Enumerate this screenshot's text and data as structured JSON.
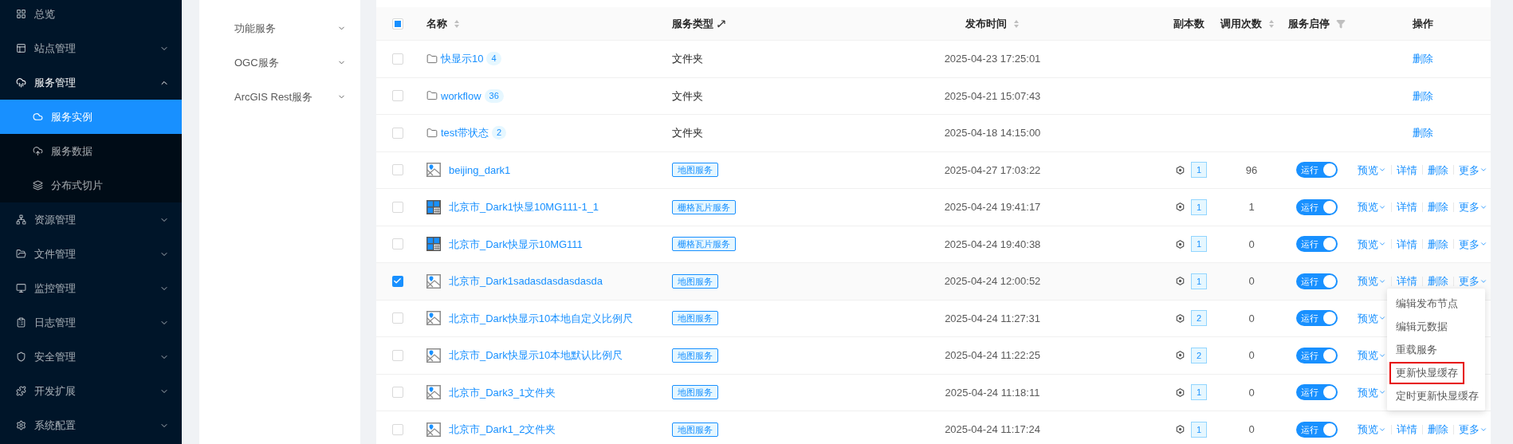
{
  "sidebar": {
    "items": [
      {
        "label": "总览",
        "kind": "link"
      },
      {
        "label": "站点管理",
        "kind": "group",
        "expanded": false
      },
      {
        "label": "服务管理",
        "kind": "group",
        "expanded": true,
        "children": [
          {
            "label": "服务实例",
            "selected": true
          },
          {
            "label": "服务数据",
            "selected": false
          },
          {
            "label": "分布式切片",
            "selected": false
          }
        ]
      },
      {
        "label": "资源管理",
        "kind": "group",
        "expanded": false
      },
      {
        "label": "文件管理",
        "kind": "group",
        "expanded": false
      },
      {
        "label": "监控管理",
        "kind": "group",
        "expanded": false
      },
      {
        "label": "日志管理",
        "kind": "group",
        "expanded": false
      },
      {
        "label": "安全管理",
        "kind": "group",
        "expanded": false
      },
      {
        "label": "开发扩展",
        "kind": "group",
        "expanded": false
      },
      {
        "label": "系统配置",
        "kind": "group",
        "expanded": false
      }
    ]
  },
  "categories": [
    {
      "label": "功能服务",
      "expanded": false
    },
    {
      "label": "OGC服务",
      "expanded": false
    },
    {
      "label": "ArcGIS Rest服务",
      "expanded": false
    }
  ],
  "table": {
    "select_all": {
      "checked": false,
      "partial": true
    },
    "columns": [
      {
        "label": "名称",
        "sortable": true,
        "filterable": false,
        "resizable": false
      },
      {
        "label": "服务类型",
        "sortable": false,
        "filterable": false,
        "resizable": true
      },
      {
        "label": "发布时间",
        "sortable": true,
        "filterable": false,
        "resizable": false
      },
      {
        "label": "副本数",
        "sortable": false,
        "filterable": false,
        "resizable": false
      },
      {
        "label": "调用次数",
        "sortable": true,
        "filterable": false,
        "resizable": false
      },
      {
        "label": "服务启停",
        "sortable": false,
        "filterable": true,
        "resizable": false
      },
      {
        "label": "操作",
        "sortable": false,
        "filterable": false,
        "resizable": false
      }
    ],
    "rows": [
      {
        "checked": false,
        "kind": "folder",
        "name": "快显示10",
        "count": "4",
        "type": "文件夹",
        "published": "2025-04-23 17:25:01",
        "actions": [
          {
            "label": "删除",
            "dropdown": false
          }
        ]
      },
      {
        "checked": false,
        "kind": "folder",
        "name": "workflow",
        "count": "36",
        "type": "文件夹",
        "published": "2025-04-21 15:07:43",
        "actions": [
          {
            "label": "删除",
            "dropdown": false
          }
        ]
      },
      {
        "checked": false,
        "kind": "folder",
        "name": "test带状态",
        "count": "2",
        "type": "文件夹",
        "published": "2025-04-18 14:15:00",
        "actions": [
          {
            "label": "删除",
            "dropdown": false
          }
        ]
      },
      {
        "checked": false,
        "kind": "map",
        "name": "beijing_dark1",
        "type": "地图服务",
        "published": "2025-04-27 17:03:22",
        "replicas": "1",
        "calls": "96",
        "running": true,
        "toggle": "运行",
        "actions": [
          {
            "label": "预览",
            "dropdown": true
          },
          {
            "label": "详情",
            "dropdown": false
          },
          {
            "label": "删除",
            "dropdown": false
          },
          {
            "label": "更多",
            "dropdown": true
          }
        ]
      },
      {
        "checked": false,
        "kind": "tile",
        "name": "北京市_Dark1快显10MG111-1_1",
        "type": "栅格瓦片服务",
        "published": "2025-04-24 19:41:17",
        "replicas": "1",
        "calls": "1",
        "running": true,
        "toggle": "运行",
        "actions": [
          {
            "label": "预览",
            "dropdown": true
          },
          {
            "label": "详情",
            "dropdown": false
          },
          {
            "label": "删除",
            "dropdown": false
          },
          {
            "label": "更多",
            "dropdown": true
          }
        ]
      },
      {
        "checked": false,
        "kind": "tile",
        "name": "北京市_Dark快显示10MG111",
        "type": "栅格瓦片服务",
        "published": "2025-04-24 19:40:38",
        "replicas": "1",
        "calls": "0",
        "running": true,
        "toggle": "运行",
        "actions": [
          {
            "label": "预览",
            "dropdown": true
          },
          {
            "label": "详情",
            "dropdown": false
          },
          {
            "label": "删除",
            "dropdown": false
          },
          {
            "label": "更多",
            "dropdown": true
          }
        ]
      },
      {
        "checked": true,
        "kind": "map",
        "name": "北京市_Dark1sadasdasdasdasda",
        "type": "地图服务",
        "published": "2025-04-24 12:00:52",
        "replicas": "1",
        "calls": "0",
        "running": true,
        "toggle": "运行",
        "actions": [
          {
            "label": "预览",
            "dropdown": true
          },
          {
            "label": "详情",
            "dropdown": false
          },
          {
            "label": "删除",
            "dropdown": false
          },
          {
            "label": "更多",
            "dropdown": true
          }
        ]
      },
      {
        "checked": false,
        "kind": "map",
        "name": "北京市_Dark快显示10本地自定义比例尺",
        "type": "地图服务",
        "published": "2025-04-24 11:27:31",
        "replicas": "2",
        "calls": "0",
        "running": true,
        "toggle": "运行",
        "actions": [
          {
            "label": "预览",
            "dropdown": true
          }
        ]
      },
      {
        "checked": false,
        "kind": "map",
        "name": "北京市_Dark快显示10本地默认比例尺",
        "type": "地图服务",
        "published": "2025-04-24 11:22:25",
        "replicas": "2",
        "calls": "0",
        "running": true,
        "toggle": "运行",
        "actions": [
          {
            "label": "预览",
            "dropdown": true
          }
        ]
      },
      {
        "checked": false,
        "kind": "map",
        "name": "北京市_Dark3_1文件夹",
        "type": "地图服务",
        "published": "2025-04-24 11:18:11",
        "replicas": "1",
        "calls": "0",
        "running": true,
        "toggle": "运行",
        "actions": [
          {
            "label": "预览",
            "dropdown": true
          }
        ]
      },
      {
        "checked": false,
        "kind": "map",
        "name": "北京市_Dark1_2文件夹",
        "type": "地图服务",
        "published": "2025-04-24 11:17:24",
        "replicas": "1",
        "calls": "0",
        "running": true,
        "toggle": "运行",
        "actions": [
          {
            "label": "预览",
            "dropdown": true
          },
          {
            "label": "详情",
            "dropdown": false
          },
          {
            "label": "删除",
            "dropdown": false
          },
          {
            "label": "更多",
            "dropdown": true
          }
        ]
      }
    ]
  },
  "more_menu": {
    "items": [
      {
        "label": "编辑发布节点",
        "highlighted": false
      },
      {
        "label": "编辑元数据",
        "highlighted": false
      },
      {
        "label": "重载服务",
        "highlighted": false
      },
      {
        "label": "更新快显缓存",
        "highlighted": true
      },
      {
        "label": "定时更新快显缓存",
        "highlighted": false
      }
    ]
  }
}
